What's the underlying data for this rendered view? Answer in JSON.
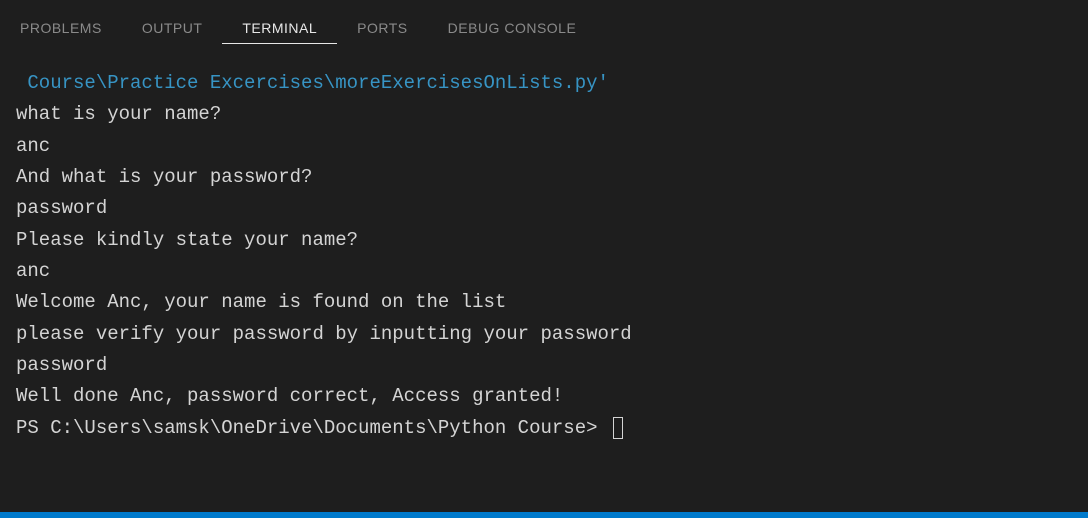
{
  "tabs": {
    "problems": "PROBLEMS",
    "output": "OUTPUT",
    "terminal": "TERMINAL",
    "ports": "PORTS",
    "debug_console": "DEBUG CONSOLE"
  },
  "terminal": {
    "path_line": " Course\\Practice Excercises\\moreExercisesOnLists.py'",
    "lines": [
      "what is your name?",
      "anc",
      "And what is your password?",
      "password",
      "Please kindly state your name?",
      "anc",
      "Welcome Anc, your name is found on the list",
      "please verify your password by inputting your password",
      "password",
      "Well done Anc, password correct, Access granted!"
    ],
    "prompt": "PS C:\\Users\\samsk\\OneDrive\\Documents\\Python Course> "
  }
}
